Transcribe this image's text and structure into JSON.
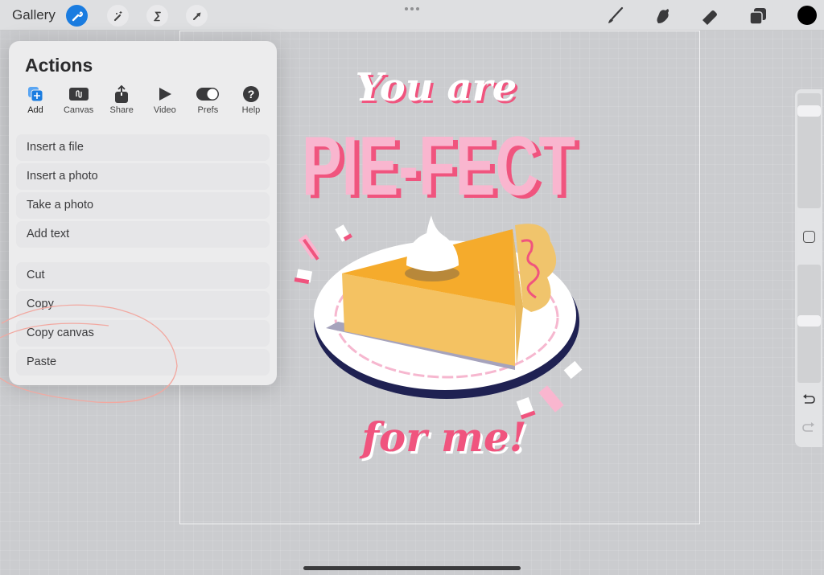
{
  "topbar": {
    "gallery_label": "Gallery",
    "left_tools": [
      {
        "name": "actions",
        "icon": "wrench-icon",
        "active": true
      },
      {
        "name": "adjustments",
        "icon": "magic-wand-icon",
        "active": false
      },
      {
        "name": "selection",
        "icon": "selection-s-icon",
        "active": false
      },
      {
        "name": "transform",
        "icon": "arrow-cursor-icon",
        "active": false
      }
    ],
    "right_tools": [
      {
        "name": "paint",
        "icon": "brush-icon"
      },
      {
        "name": "smudge",
        "icon": "smudge-finger-icon"
      },
      {
        "name": "erase",
        "icon": "eraser-icon"
      },
      {
        "name": "layers",
        "icon": "layers-icon"
      }
    ],
    "current_color": "#000000",
    "accent_color": "#1a7ce0"
  },
  "actions_panel": {
    "title": "Actions",
    "tabs": [
      {
        "label": "Add",
        "icon": "add-icon",
        "active": true
      },
      {
        "label": "Canvas",
        "icon": "canvas-icon",
        "active": false
      },
      {
        "label": "Share",
        "icon": "share-icon",
        "active": false
      },
      {
        "label": "Video",
        "icon": "play-icon",
        "active": false
      },
      {
        "label": "Prefs",
        "icon": "toggle-icon",
        "active": false
      },
      {
        "label": "Help",
        "icon": "help-icon",
        "active": false
      }
    ],
    "group1": [
      "Insert a file",
      "Insert a photo",
      "Take a photo",
      "Add text"
    ],
    "group2": [
      "Cut",
      "Copy",
      "Copy canvas",
      "Paste"
    ]
  },
  "artwork": {
    "line1": "You are",
    "line2": "PIE-FECT",
    "line3": "for me!",
    "colors": {
      "pink_dark": "#f0547e",
      "pink_light": "#f9b6cf",
      "white": "#ffffff",
      "crust": "#f0c46c",
      "filling": "#f5ab2c",
      "plate_rim": "#1f2152",
      "doily": "#f6b7cf"
    }
  },
  "sidebar": {
    "brush_size_level": 0.12,
    "opacity_level": 0.47,
    "modify_button_icon": "square-icon",
    "undo_icon": "undo-icon",
    "redo_icon": "redo-icon"
  },
  "annotation_color": "#f2a8a0"
}
